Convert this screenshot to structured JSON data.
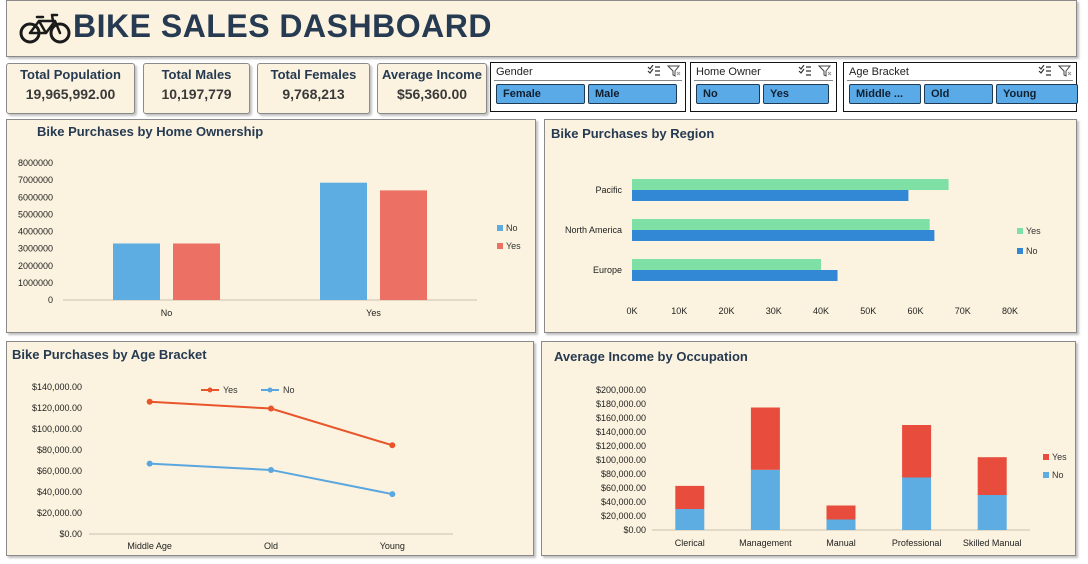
{
  "header": {
    "title": "BIKE SALES DASHBOARD",
    "icon": "bicycle-icon"
  },
  "kpis": [
    {
      "label": "Total Population",
      "value": "19,965,992.00"
    },
    {
      "label": "Total Males",
      "value": "10,197,779"
    },
    {
      "label": "Total Females",
      "value": "9,768,213"
    },
    {
      "label": "Average Income",
      "value": "$56,360.00"
    }
  ],
  "slicers": [
    {
      "title": "Gender",
      "options": [
        "Female",
        "Male"
      ]
    },
    {
      "title": "Home Owner",
      "options": [
        "No",
        "Yes"
      ]
    },
    {
      "title": "Age Bracket",
      "options": [
        "Middle ...",
        "Old",
        "Young"
      ]
    }
  ],
  "colors": {
    "panel_bg": "#fbf3df",
    "title": "#263a52",
    "no_blue": "#5dade2",
    "yes_red": "#ec7063",
    "region_yes": "#7fe0a6",
    "region_no": "#3388d6",
    "age_yes": "#e8552b",
    "age_no": "#5aa7e0",
    "occ_yes": "#e74c3c",
    "occ_no": "#5dade2"
  },
  "chart_data": [
    {
      "id": "home",
      "type": "bar",
      "title": "Bike Purchases by Home Ownership",
      "categories": [
        "No",
        "Yes"
      ],
      "series": [
        {
          "name": "No",
          "values": [
            3300000,
            6850000
          ]
        },
        {
          "name": "Yes",
          "values": [
            3300000,
            6400000
          ]
        }
      ],
      "yticks": [
        "8000000",
        "7000000",
        "6000000",
        "5000000",
        "4000000",
        "3000000",
        "2000000",
        "1000000",
        "0"
      ],
      "ylim": [
        0,
        8000000
      ],
      "legend": "right"
    },
    {
      "id": "region",
      "type": "bar",
      "orientation": "horizontal",
      "title": "Bike Purchases by Region",
      "categories": [
        "Pacific",
        "North America",
        "Europe"
      ],
      "series": [
        {
          "name": "Yes",
          "values": [
            67000,
            63000,
            40000
          ]
        },
        {
          "name": "No",
          "values": [
            58500,
            64000,
            43500
          ]
        }
      ],
      "xticks": [
        "0K",
        "10K",
        "20K",
        "30K",
        "40K",
        "50K",
        "60K",
        "70K",
        "80K"
      ],
      "xlim": [
        0,
        80000
      ],
      "legend": "right"
    },
    {
      "id": "age",
      "type": "line",
      "title": "Bike Purchases by Age Bracket",
      "categories": [
        "Middle Age",
        "Old",
        "Young"
      ],
      "series": [
        {
          "name": "Yes",
          "values": [
            126000,
            119500,
            84500
          ]
        },
        {
          "name": "No",
          "values": [
            67000,
            61000,
            38000
          ]
        }
      ],
      "yticks": [
        "$140,000.00",
        "$120,000.00",
        "$100,000.00",
        "$80,000.00",
        "$60,000.00",
        "$40,000.00",
        "$20,000.00",
        "$0.00"
      ],
      "ylim": [
        0,
        140000
      ],
      "legend": "top"
    },
    {
      "id": "occupation",
      "type": "bar",
      "stacked": true,
      "title": "Average Income by Occupation",
      "categories": [
        "Clerical",
        "Management",
        "Manual",
        "Professional",
        "Skilled Manual"
      ],
      "series": [
        {
          "name": "No",
          "values": [
            30000,
            86000,
            15000,
            75000,
            50000
          ]
        },
        {
          "name": "Yes",
          "values": [
            33000,
            89000,
            20000,
            75000,
            54000
          ]
        }
      ],
      "yticks": [
        "$200,000.00",
        "$180,000.00",
        "$160,000.00",
        "$140,000.00",
        "$120,000.00",
        "$100,000.00",
        "$80,000.00",
        "$60,000.00",
        "$40,000.00",
        "$20,000.00",
        "$0.00"
      ],
      "ylim": [
        0,
        200000
      ],
      "legend": "right"
    }
  ]
}
